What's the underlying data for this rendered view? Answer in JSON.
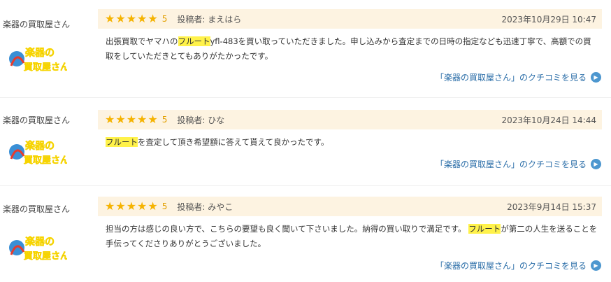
{
  "reviews": [
    {
      "shop": "楽器の買取屋さん",
      "rating": "5",
      "poster": "投稿者: まえはら",
      "date": "2023年10月29日 10:47",
      "pre": "出張買取でヤマハの",
      "hl": "フルート",
      "post": "yfl-483を買い取っていただきました。申し込みから査定までの日時の指定なども迅速丁寧で、高額での買取をしていただきとてもありがたかったです。",
      "more": "「楽器の買取屋さん」のクチコミを見る"
    },
    {
      "shop": "楽器の買取屋さん",
      "rating": "5",
      "poster": "投稿者: ひな",
      "date": "2023年10月24日 14:44",
      "pre": "",
      "hl": "フルート",
      "post": "を査定して頂き希望額に答えて貰えて良かったです。",
      "more": "「楽器の買取屋さん」のクチコミを見る"
    },
    {
      "shop": "楽器の買取屋さん",
      "rating": "5",
      "poster": "投稿者: みやこ",
      "date": "2023年9月14日 15:37",
      "pre": "担当の方は感じの良い方で、こちらの要望も良く聞いて下さいました。納得の買い取りで満足です。 ",
      "hl": "フルート",
      "post": "が第二の人生を送ることを手伝ってくださりありがとうございました。",
      "more": "「楽器の買取屋さん」のクチコミを見る"
    }
  ],
  "logo": {
    "line1": "楽器の",
    "line2": "買取屋さん"
  },
  "icons": {
    "star": "star-icon",
    "play": "play-circle-icon"
  },
  "colors": {
    "star": "#f5b301",
    "link": "#2b6ea8",
    "header_bg": "#fdf3e1",
    "highlight": "#fff24a"
  }
}
